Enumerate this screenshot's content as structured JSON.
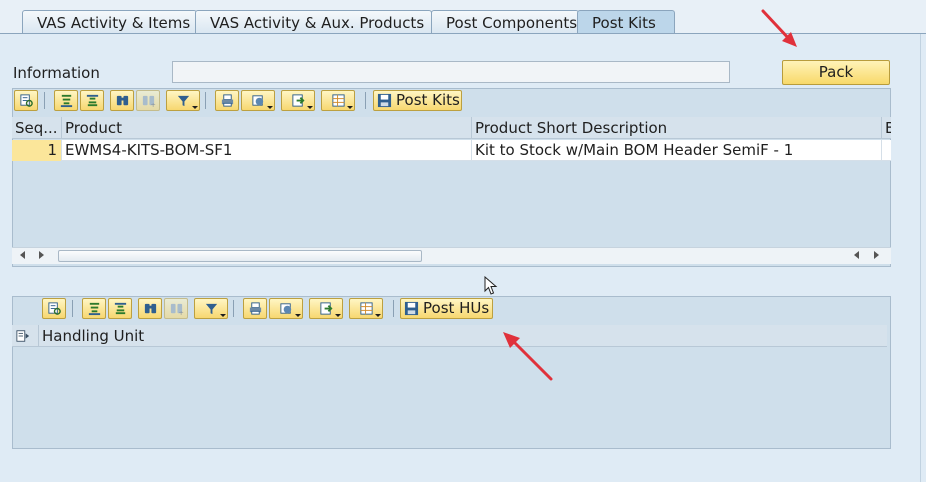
{
  "tabs": [
    {
      "label": "VAS Activity & Items",
      "active": false
    },
    {
      "label": "VAS Activity & Aux. Products",
      "active": false
    },
    {
      "label": "Post Components",
      "active": false
    },
    {
      "label": "Post Kits",
      "active": true
    }
  ],
  "information": {
    "label": "Information",
    "value": ""
  },
  "pack_button": {
    "label": "Pack"
  },
  "kits_grid": {
    "toolbar": {
      "icons": [
        "details-icon",
        "sort-ascending-icon",
        "sort-descending-icon",
        "find-icon",
        "find-next-icon",
        "filter-icon",
        "print-icon",
        "views-icon",
        "export-icon",
        "layout-icon",
        "save-icon"
      ],
      "post_button_label": "Post Kits"
    },
    "columns": [
      "Seq...",
      "Product",
      "Product Short Description",
      "B"
    ],
    "rows": [
      {
        "seq": "1",
        "product": "EWMS4-KITS-BOM-SF1",
        "description": "Kit to Stock w/Main BOM Header SemiF - 1"
      }
    ]
  },
  "hu_grid": {
    "toolbar": {
      "post_button_label": "Post HUs"
    },
    "columns": [
      "Handling Unit"
    ]
  },
  "colors": {
    "accent_button": "#f8d96a",
    "annotation_arrow": "#e0313b",
    "panel": "#cfdfeb"
  }
}
